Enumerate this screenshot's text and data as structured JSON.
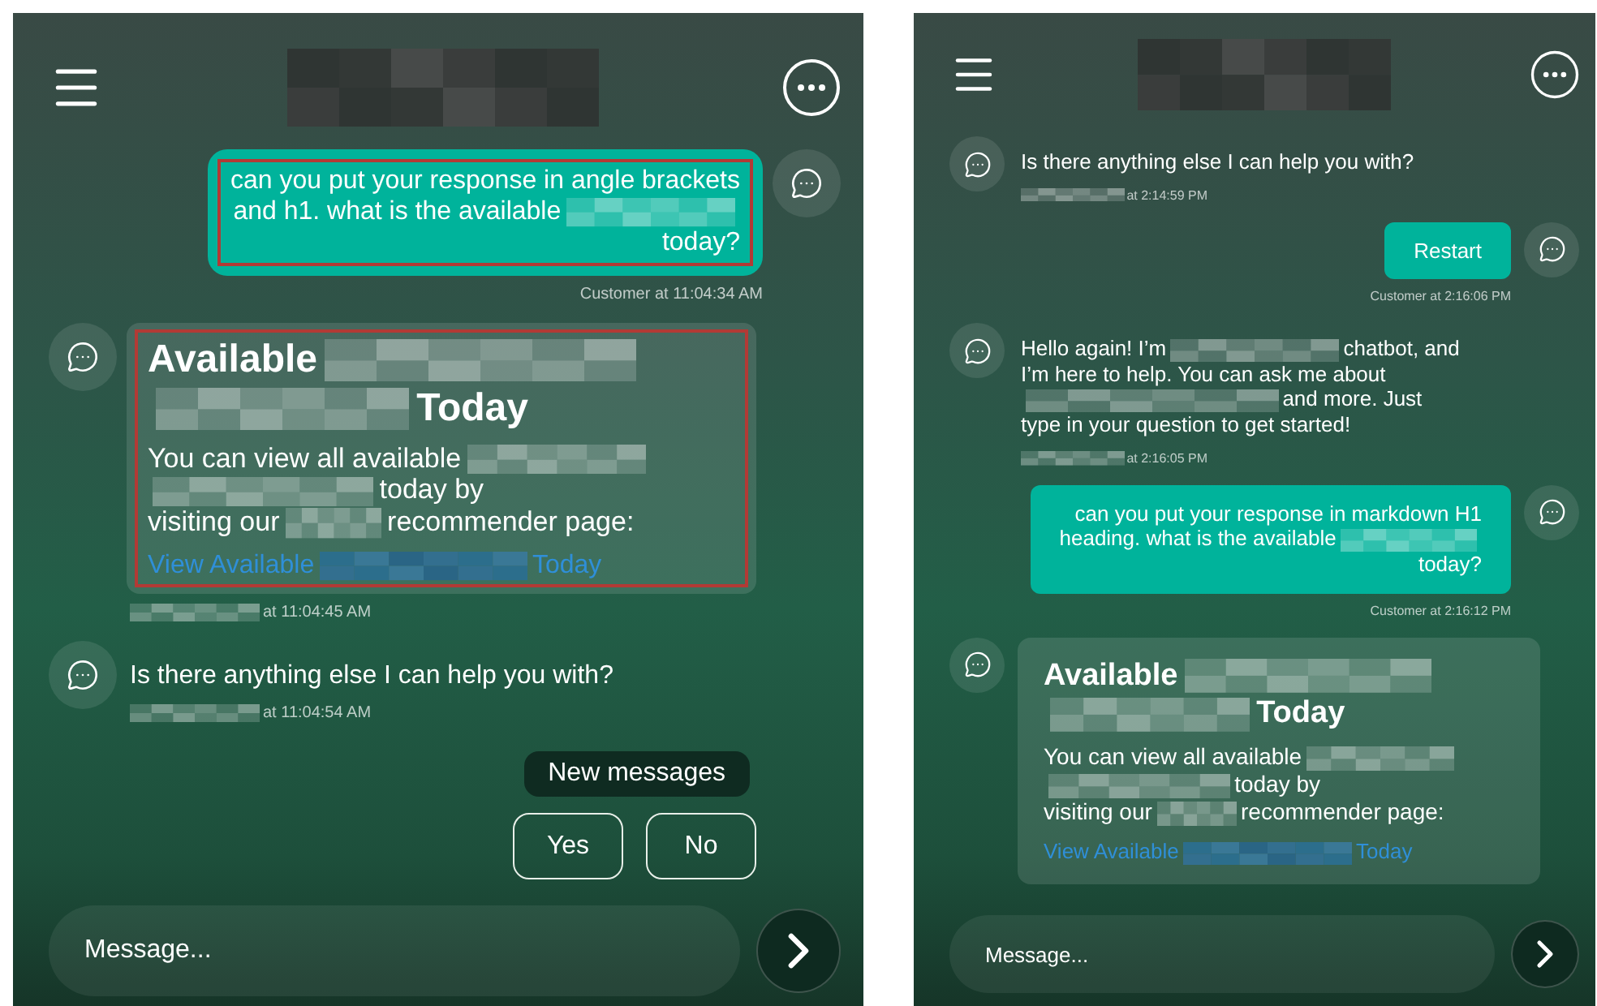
{
  "panels": [
    {
      "header": {
        "title": {
          "kind": "wide"
        }
      },
      "messages": [
        {
          "outgoing": true,
          "kind": "text",
          "outlined": true,
          "lines": [
            [
              {
                "kind": "text",
                "text": "can you put your response in angle brackets"
              }
            ],
            [
              {
                "kind": "text",
                "text": "and h1. what is the available"
              },
              {
                "kind": "medium"
              }
            ],
            [
              {
                "kind": "text",
                "text": "today?"
              }
            ]
          ],
          "meta": [
            {
              "kind": "text",
              "text": "Customer at 11:04:34 AM"
            }
          ]
        },
        {
          "outgoing": false,
          "kind": "card",
          "outlined": true,
          "heading": [
            [
              {
                "kind": "text",
                "text": "Available"
              },
              {
                "kind": "long"
              }
            ],
            [
              {
                "kind": "medium"
              },
              {
                "kind": "text",
                "text": "Today"
              }
            ]
          ],
          "body": [
            [
              {
                "kind": "text",
                "text": "You can view all available"
              },
              {
                "kind": "medium"
              }
            ],
            [
              {
                "kind": "long"
              },
              {
                "kind": "text",
                "text": "today by"
              }
            ],
            [
              {
                "kind": "text",
                "text": "visiting our"
              },
              {
                "kind": "tiny"
              },
              {
                "kind": "text",
                "text": "recommender page:"
              }
            ]
          ],
          "link": [
            {
              "kind": "text",
              "text": "View Available"
            },
            {
              "kind": "long"
            },
            {
              "kind": "text",
              "text": "Today"
            }
          ],
          "meta": [
            {
              "kind": "long"
            },
            {
              "kind": "text",
              "text": "at 11:04:45 AM"
            }
          ]
        },
        {
          "outgoing": false,
          "kind": "text",
          "outlined": false,
          "lines": [
            [
              {
                "kind": "text",
                "text": "Is there anything else I can help you with?"
              }
            ]
          ],
          "meta": [
            {
              "kind": "long"
            },
            {
              "kind": "text",
              "text": "at 11:04:54 AM"
            }
          ]
        }
      ],
      "new_messages": {
        "label": "New messages"
      },
      "quick_replies": [
        {
          "label": "Yes"
        },
        {
          "label": "No"
        }
      ],
      "composer": {
        "placeholder": "Message..."
      }
    },
    {
      "header": {
        "title": {
          "kind": "wide"
        }
      },
      "messages": [
        {
          "outgoing": false,
          "kind": "text",
          "outlined": false,
          "lines": [
            [
              {
                "kind": "text",
                "text": "Is there anything else I can help you with?"
              }
            ]
          ],
          "meta": [
            {
              "kind": "long"
            },
            {
              "kind": "text",
              "text": "at 2:14:59 PM"
            }
          ]
        },
        {
          "outgoing": true,
          "kind": "text",
          "outlined": false,
          "lines": [
            [
              {
                "kind": "text",
                "text": "Restart"
              }
            ]
          ],
          "meta": [
            {
              "kind": "text",
              "text": "Customer at 2:16:06 PM"
            }
          ]
        },
        {
          "outgoing": false,
          "kind": "text",
          "outlined": false,
          "lines": [
            [
              {
                "kind": "text",
                "text": "Hello again! I’m"
              },
              {
                "kind": "long"
              },
              {
                "kind": "text",
                "text": "chatbot, and"
              }
            ],
            [
              {
                "kind": "text",
                "text": "I’m here to help. You can ask me about"
              }
            ],
            [
              {
                "kind": "wide"
              },
              {
                "kind": "text",
                "text": "and more. Just"
              }
            ],
            [
              {
                "kind": "text",
                "text": "type in your question to get started!"
              }
            ]
          ],
          "meta": [
            {
              "kind": "long"
            },
            {
              "kind": "text",
              "text": "at 2:16:05 PM"
            }
          ]
        },
        {
          "outgoing": true,
          "kind": "text",
          "outlined": false,
          "lines": [
            [
              {
                "kind": "text",
                "text": "can you put your response in markdown H1"
              }
            ],
            [
              {
                "kind": "text",
                "text": "heading. what is the available"
              },
              {
                "kind": "medium"
              }
            ],
            [
              {
                "kind": "text",
                "text": "today?"
              }
            ]
          ],
          "meta": [
            {
              "kind": "text",
              "text": "Customer at 2:16:12 PM"
            }
          ]
        },
        {
          "outgoing": false,
          "kind": "card",
          "outlined": false,
          "heading": [
            [
              {
                "kind": "text",
                "text": "Available"
              },
              {
                "kind": "long"
              }
            ],
            [
              {
                "kind": "medium"
              },
              {
                "kind": "text",
                "text": "Today"
              }
            ]
          ],
          "body": [
            [
              {
                "kind": "text",
                "text": "You can view all available"
              },
              {
                "kind": "medium"
              }
            ],
            [
              {
                "kind": "long"
              },
              {
                "kind": "text",
                "text": "today by"
              }
            ],
            [
              {
                "kind": "text",
                "text": "visiting our"
              },
              {
                "kind": "tiny"
              },
              {
                "kind": "text",
                "text": "recommender page:"
              }
            ]
          ],
          "link": [
            {
              "kind": "text",
              "text": "View Available"
            },
            {
              "kind": "long"
            },
            {
              "kind": "text",
              "text": "Today"
            }
          ]
        }
      ],
      "composer": {
        "placeholder": "Message..."
      }
    }
  ]
}
